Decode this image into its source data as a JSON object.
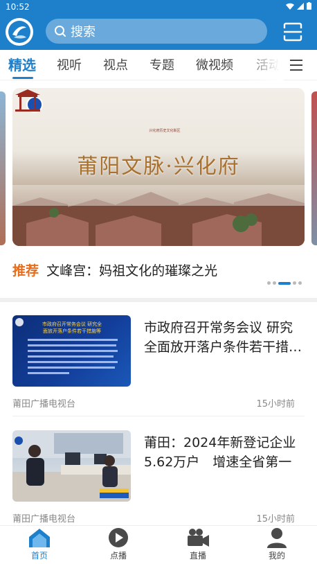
{
  "status_bar": {
    "time": "10:52"
  },
  "header": {
    "search_placeholder": "搜索",
    "accent_color": "#1e7fcb"
  },
  "tabs": [
    {
      "label": "精选",
      "active": true
    },
    {
      "label": "视听"
    },
    {
      "label": "视点"
    },
    {
      "label": "专题"
    },
    {
      "label": "微视频"
    },
    {
      "label": "活动"
    }
  ],
  "banner": {
    "title": "莆阳文脉·兴化府",
    "subtitle": "兴化府历史文化街区",
    "indicator": {
      "count": 5,
      "active_index": 2
    }
  },
  "featured": {
    "tag": "推荐",
    "title": "文峰宫：妈祖文化的璀璨之光"
  },
  "news": [
    {
      "title": "市政府召开常务会议 研究全面放开落户条件若干措…",
      "thumb_headline": "市政府召开常务会议 研究全面放开落户条件若干措施等",
      "source": "莆田广播电视台",
      "time": "15小时前"
    },
    {
      "title": "莆田：2024年新登记企业5.62万户　增速全省第一",
      "source": "莆田广播电视台",
      "time": "15小时前"
    }
  ],
  "bottom_nav": [
    {
      "label": "首页",
      "icon": "home-icon",
      "active": true
    },
    {
      "label": "点播",
      "icon": "play-icon"
    },
    {
      "label": "直播",
      "icon": "video-camera-icon"
    },
    {
      "label": "我的",
      "icon": "user-icon"
    }
  ]
}
